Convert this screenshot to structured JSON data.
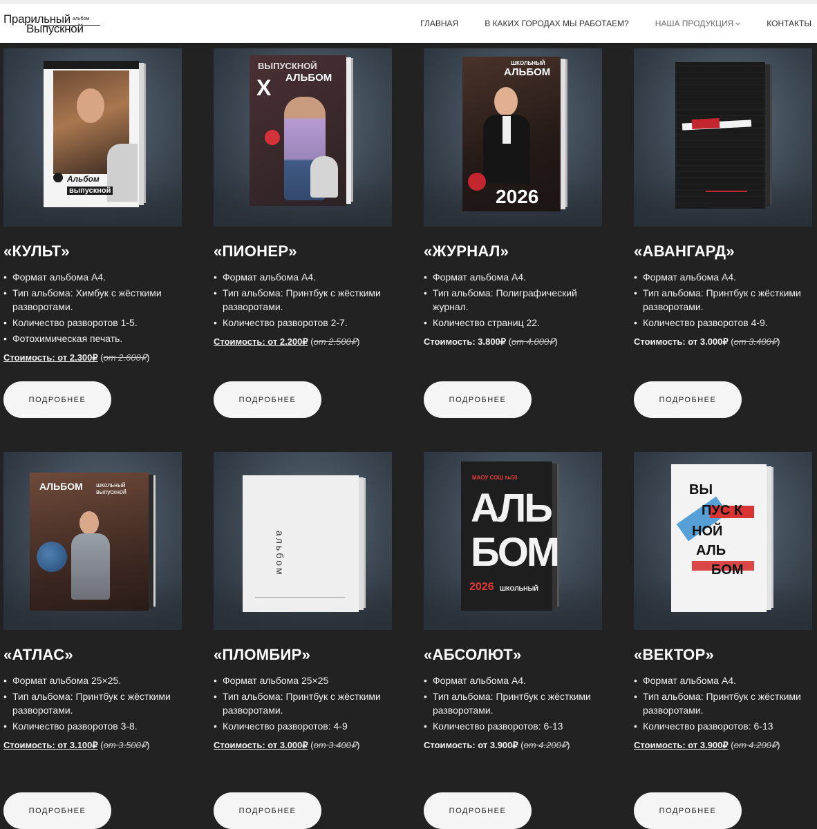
{
  "header": {
    "logo": {
      "line1": "Прарильный",
      "line2": "Выпускной",
      "small": "альбом"
    },
    "nav": [
      {
        "label": "ГЛАВНАЯ"
      },
      {
        "label": "В КАКИХ ГОРОДАХ МЫ РАБОТАЕМ?"
      },
      {
        "label": "НАША ПРОДУКЦИЯ"
      },
      {
        "label": "КОНТАКТЫ"
      }
    ]
  },
  "products": [
    {
      "title": "«КУЛЬТ»",
      "specs": [
        "Формат альбома А4.",
        "Тип альбома: Химбук с жёсткими разворотами.",
        " Количество разворотов 1-5.",
        "Фотохимическая печать."
      ],
      "price_label": "Стоимость: от 2.300₽",
      "price_old": "от 2.600₽",
      "button": "ПОДРОБНЕЕ",
      "cover_text": [
        "Альбом",
        "выпускной"
      ]
    },
    {
      "title": "«ПИОНЕР»",
      "specs": [
        "Формат альбома А4.",
        "Тип альбома: Принтбук с жёсткими разворотами.",
        "Количество разворотов 2-7."
      ],
      "price_label": "Стоимость: от 2.200₽",
      "price_old": "от 2.500₽",
      "button": "ПОДРОБНЕЕ",
      "cover_text": [
        "ВЫПУСКНОЙ",
        "АЛЬБОМ"
      ]
    },
    {
      "title": "«ЖУРНАЛ»",
      "specs": [
        "Формат альбома А4.",
        "Тип альбома: Полиграфический журнал.",
        "Количество страниц 22."
      ],
      "price_label": "Стоимость: 3.800₽",
      "price_old": "от 4.000₽",
      "button": "ПОДРОБНЕЕ",
      "cover_text": [
        "ШКОЛЬНЫЙ",
        "АЛЬБОМ",
        "2026"
      ]
    },
    {
      "title": "«АВАНГАРД»",
      "specs": [
        "Формат альбома А4.",
        "Тип альбома: Принтбук с жёсткими разворотами.",
        "Количество разворотов 4-9."
      ],
      "price_label": "Стоимость: от 3.000₽",
      "price_old": "от 3.400₽",
      "button": "ПОДРОБНЕЕ",
      "cover_text": []
    },
    {
      "title": "«АТЛАС»",
      "specs": [
        " Формат альбома 25×25.",
        "Тип альбома: Принтбук с жёсткими разворотами.",
        "Количество разворотов 3-8."
      ],
      "price_label": "Стоимость: от 3.100₽",
      "price_old": "от 3.500₽",
      "button": "ПОДРОБНЕЕ",
      "cover_text": [
        "АЛЬБОМ",
        "школьный",
        "выпускной"
      ]
    },
    {
      "title": "«ПЛОМБИР»",
      "specs": [
        " Формат альбома 25×25",
        "Тип альбома: Принтбук с жёсткими разворотами.",
        " Количество разворотов: 4-9"
      ],
      "price_label": "Стоимость: от 3.000₽",
      "price_old": "от 3.400₽",
      "button": "ПОДРОБНЕЕ",
      "cover_text": [
        "альбом"
      ]
    },
    {
      "title": "«АБСОЛЮТ»",
      "specs": [
        "Формат альбома А4.",
        "Тип альбома: Принтбук с жёсткими разворотами.",
        "Количество разворотов: 6-13"
      ],
      "price_label": "Стоимость: от 3.900₽",
      "price_old": "от 4.200₽",
      "button": "ПОДРОБНЕЕ",
      "cover_text": [
        "МАОУ СОШ №50",
        "АЛЬ",
        "БОМ",
        "2026",
        "ШКОЛЬНЫЙ"
      ]
    },
    {
      "title": "«ВЕКТОР»",
      "specs": [
        "Формат альбома А4.",
        "Тип альбома: Принтбук с жёсткими разворотами.",
        "Количество разворотов: 6-13"
      ],
      "price_label": "Стоимость: от 3.900₽",
      "price_old": "от 4.200₽",
      "button": "ПОДРОБНЕЕ",
      "cover_text": [
        "ВЫ",
        "ПУС К",
        "НОЙ",
        "АЛЬ",
        "БОМ"
      ]
    }
  ],
  "colors": {
    "page_bg": "#222222",
    "header_bg": "#ffffff",
    "button_bg": "#f5f5f5",
    "text": "#f0f0f0"
  }
}
